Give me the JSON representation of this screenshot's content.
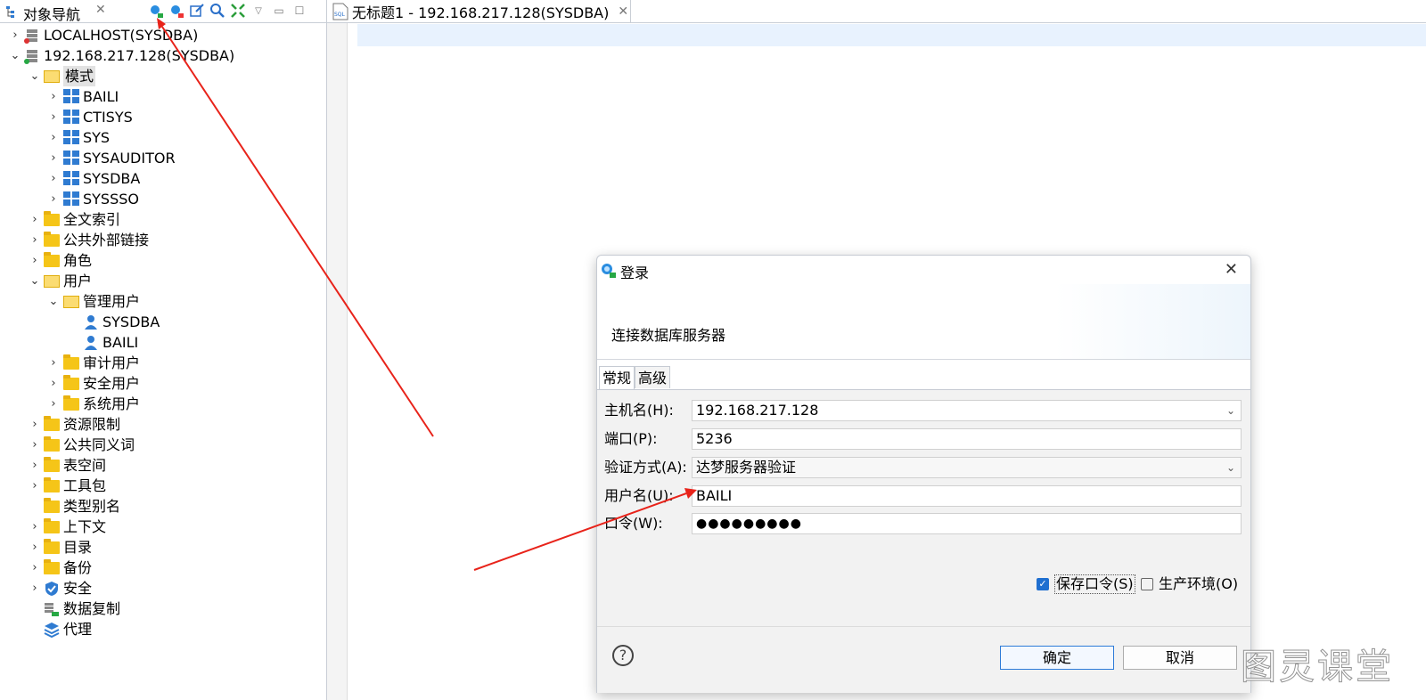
{
  "navigator": {
    "tab_title": "对象导航",
    "tab_close": "✕",
    "tree": [
      {
        "label": "LOCALHOST(SYSDBA)",
        "icon": "server-icon",
        "level": 0,
        "toggle": "›"
      },
      {
        "label": "192.168.217.128(SYSDBA)",
        "icon": "server-connected-icon",
        "level": 0,
        "toggle": "⌄"
      },
      {
        "label": "模式",
        "icon": "folder-open-icon",
        "level": 1,
        "toggle": "⌄"
      },
      {
        "label": "BAILI",
        "icon": "schema-icon",
        "level": 2,
        "toggle": "›"
      },
      {
        "label": "CTISYS",
        "icon": "schema-icon",
        "level": 2,
        "toggle": "›"
      },
      {
        "label": "SYS",
        "icon": "schema-icon",
        "level": 2,
        "toggle": "›"
      },
      {
        "label": "SYSAUDITOR",
        "icon": "schema-icon",
        "level": 2,
        "toggle": "›"
      },
      {
        "label": "SYSDBA",
        "icon": "schema-icon",
        "level": 2,
        "toggle": "›"
      },
      {
        "label": "SYSSSO",
        "icon": "schema-icon",
        "level": 2,
        "toggle": "›"
      },
      {
        "label": "全文索引",
        "icon": "folder-icon",
        "level": 1,
        "toggle": "›"
      },
      {
        "label": "公共外部链接",
        "icon": "folder-icon",
        "level": 1,
        "toggle": "›"
      },
      {
        "label": "角色",
        "icon": "folder-icon",
        "level": 1,
        "toggle": "›"
      },
      {
        "label": "用户",
        "icon": "folder-open-icon",
        "level": 1,
        "toggle": "⌄"
      },
      {
        "label": "管理用户",
        "icon": "folder-open-icon",
        "level": 2,
        "toggle": "⌄"
      },
      {
        "label": "SYSDBA",
        "icon": "user-icon",
        "level": 3,
        "toggle": ""
      },
      {
        "label": "BAILI",
        "icon": "user-icon",
        "level": 3,
        "toggle": ""
      },
      {
        "label": "审计用户",
        "icon": "folder-icon",
        "level": 2,
        "toggle": "›"
      },
      {
        "label": "安全用户",
        "icon": "folder-icon",
        "level": 2,
        "toggle": "›"
      },
      {
        "label": "系统用户",
        "icon": "folder-icon",
        "level": 2,
        "toggle": "›"
      },
      {
        "label": "资源限制",
        "icon": "folder-icon",
        "level": 1,
        "toggle": "›"
      },
      {
        "label": "公共同义词",
        "icon": "folder-icon",
        "level": 1,
        "toggle": "›"
      },
      {
        "label": "表空间",
        "icon": "folder-icon",
        "level": 1,
        "toggle": "›"
      },
      {
        "label": "工具包",
        "icon": "folder-icon",
        "level": 1,
        "toggle": "›"
      },
      {
        "label": "类型别名",
        "icon": "folder-icon",
        "level": 1,
        "toggle": ""
      },
      {
        "label": "上下文",
        "icon": "folder-icon",
        "level": 1,
        "toggle": "›"
      },
      {
        "label": "目录",
        "icon": "folder-icon",
        "level": 1,
        "toggle": "›"
      },
      {
        "label": "备份",
        "icon": "folder-icon",
        "level": 1,
        "toggle": "›"
      },
      {
        "label": "安全",
        "icon": "shield-icon",
        "level": 1,
        "toggle": "›"
      },
      {
        "label": "数据复制",
        "icon": "replication-icon",
        "level": 1,
        "toggle": ""
      },
      {
        "label": "代理",
        "icon": "layers-icon",
        "level": 1,
        "toggle": ""
      }
    ]
  },
  "editor": {
    "tab_title": "无标题1 - 192.168.217.128(SYSDBA)",
    "tab_icon_label": "SQL",
    "tab_close": "✕"
  },
  "dialog": {
    "title": "登录",
    "close": "✕",
    "subtitle": "连接数据库服务器",
    "tabs": [
      "常规",
      "高级"
    ],
    "fields": {
      "host_label": "主机名(H):",
      "host_value": "192.168.217.128",
      "port_label": "端口(P):",
      "port_value": "5236",
      "auth_label": "验证方式(A):",
      "auth_value": "达梦服务器验证",
      "user_label": "用户名(U):",
      "user_value": "BAILI",
      "pwd_label": "口令(W):",
      "pwd_value": "●●●●●●●●●"
    },
    "save_pwd": {
      "label": "保存口令(S)",
      "checked": true
    },
    "prod_env": {
      "label": "生产环境(O)",
      "checked": false
    },
    "help": "?",
    "ok": "确定",
    "cancel": "取消"
  },
  "watermark": "图灵课堂",
  "colors": {
    "accent": "#1f6fd0",
    "arrow": "#e8231a",
    "folder": "#f5c518"
  }
}
